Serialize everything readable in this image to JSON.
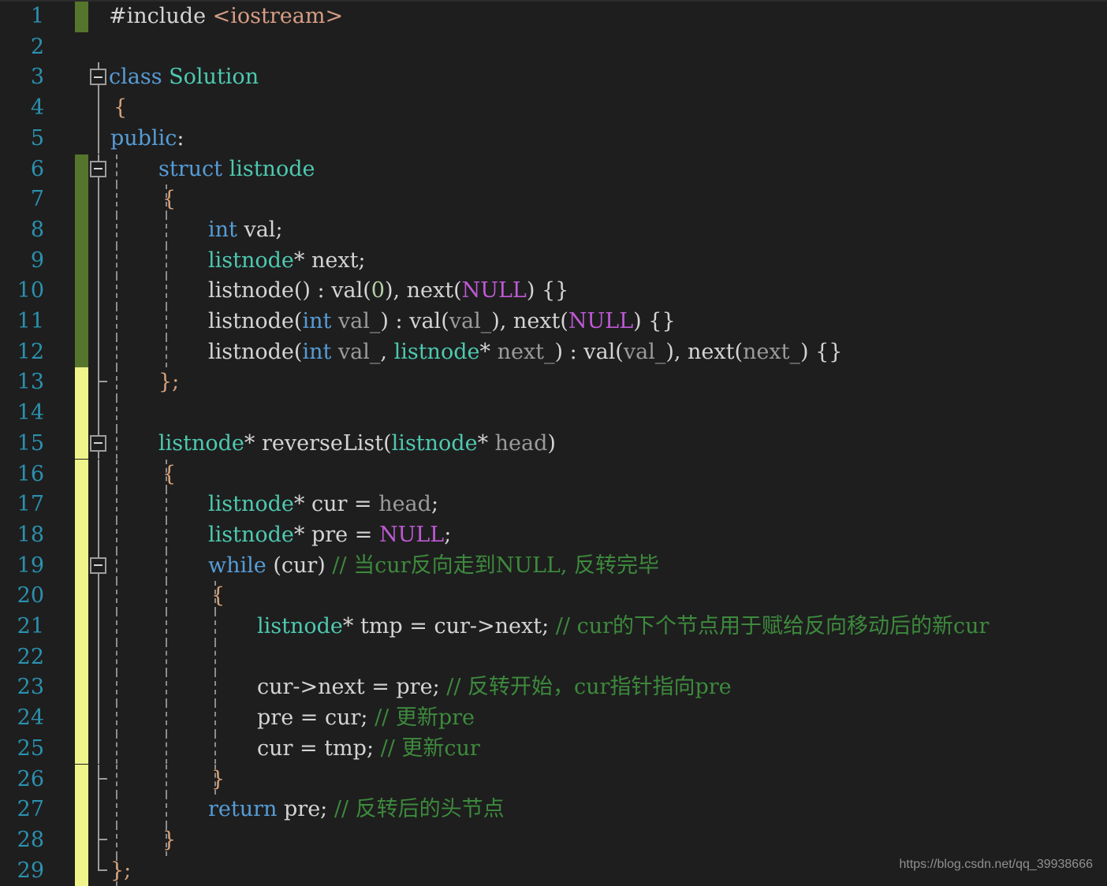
{
  "editor": {
    "background": "#1e1e1e",
    "line_number_color": "#2b91af",
    "change_marker_saved_color": "#55752c",
    "change_marker_unsaved_color": "#eef48a",
    "comment_color": "#3d8a3d",
    "keyword_color": "#569cd6",
    "type_color": "#4ec9b0",
    "string_color": "#d69d85",
    "macro_color": "#be5ad4",
    "number_color": "#b5cea8",
    "variable_color": "#9b9b9b",
    "default_text_color": "#d4d4d4",
    "language": "C++",
    "total_lines": 29
  },
  "watermark": {
    "text": "https://blog.csdn.net/qq_39938666"
  },
  "line_numbers": [
    "1",
    "2",
    "3",
    "4",
    "5",
    "6",
    "7",
    "8",
    "9",
    "10",
    "11",
    "12",
    "13",
    "14",
    "15",
    "16",
    "17",
    "18",
    "19",
    "20",
    "21",
    "22",
    "23",
    "24",
    "25",
    "26",
    "27",
    "28",
    "29"
  ],
  "change_markers": [
    "green",
    "none",
    "none",
    "none",
    "none",
    "green",
    "green",
    "green",
    "green",
    "green",
    "green",
    "green",
    "yellow",
    "yellow",
    "yellow",
    "yellow",
    "yellow",
    "yellow",
    "yellow",
    "yellow",
    "yellow",
    "yellow",
    "yellow",
    "yellow",
    "yellow",
    "yellow",
    "yellow",
    "yellow",
    "yellow"
  ],
  "code_lines": [
    {
      "n": "1",
      "text": "#include <iostream>"
    },
    {
      "n": "2",
      "text": ""
    },
    {
      "n": "3",
      "text": "class Solution"
    },
    {
      "n": "4",
      "text": "{"
    },
    {
      "n": "5",
      "text": "public:"
    },
    {
      "n": "6",
      "text": "    struct listnode"
    },
    {
      "n": "7",
      "text": "    {"
    },
    {
      "n": "8",
      "text": "        int val;"
    },
    {
      "n": "9",
      "text": "        listnode* next;"
    },
    {
      "n": "10",
      "text": "        listnode() : val(0), next(NULL) {}"
    },
    {
      "n": "11",
      "text": "        listnode(int val_) : val(val_), next(NULL) {}"
    },
    {
      "n": "12",
      "text": "        listnode(int val_, listnode* next_) : val(val_), next(next_) {}"
    },
    {
      "n": "13",
      "text": "    };"
    },
    {
      "n": "14",
      "text": ""
    },
    {
      "n": "15",
      "text": "    listnode* reverseList(listnode* head)"
    },
    {
      "n": "16",
      "text": "    {"
    },
    {
      "n": "17",
      "text": "        listnode* cur = head;"
    },
    {
      "n": "18",
      "text": "        listnode* pre = NULL;"
    },
    {
      "n": "19",
      "text": "        while (cur) // 当cur反向走到NULL, 反转完毕"
    },
    {
      "n": "20",
      "text": "        {"
    },
    {
      "n": "21",
      "text": "            listnode* tmp = cur->next; // cur的下个节点用于赋给反向移动后的新cur"
    },
    {
      "n": "22",
      "text": ""
    },
    {
      "n": "23",
      "text": "            cur->next = pre; // 反转开始，cur指针指向pre"
    },
    {
      "n": "24",
      "text": "            pre = cur; // 更新pre"
    },
    {
      "n": "25",
      "text": "            cur = tmp; // 更新cur"
    },
    {
      "n": "26",
      "text": "        }"
    },
    {
      "n": "27",
      "text": "        return pre; // 反转后的头节点"
    },
    {
      "n": "28",
      "text": "    }"
    },
    {
      "n": "29",
      "text": "};"
    }
  ],
  "comments": {
    "line19": "// 当cur反向走到NULL, 反转完毕",
    "line21": "// cur的下个节点用于赋给反向移动后的新cur",
    "line23": "// 反转开始，cur指针指向pre",
    "line24": "// 更新pre",
    "line25": "// 更新cur",
    "line27": "// 反转后的头节点"
  },
  "fold_regions": [
    {
      "start_line": "3",
      "end_line": "29",
      "label": "class-Solution-fold"
    },
    {
      "start_line": "6",
      "end_line": "13",
      "label": "struct-listnode-fold"
    },
    {
      "start_line": "15",
      "end_line": "28",
      "label": "reverseList-fold"
    },
    {
      "start_line": "19",
      "end_line": "26",
      "label": "while-loop-fold"
    }
  ],
  "tokens": {
    "l1": [
      {
        "t": "#include",
        "c": "pre"
      },
      {
        "t": " ",
        "c": "punc"
      },
      {
        "t": "<iostream>",
        "c": "str"
      }
    ],
    "l3": [
      {
        "t": "class",
        "c": "kw"
      },
      {
        "t": " ",
        "c": "punc"
      },
      {
        "t": "Solution",
        "c": "type"
      }
    ],
    "l4": [
      {
        "t": "{",
        "c": "brace"
      }
    ],
    "l5": [
      {
        "t": "public",
        "c": "kw"
      },
      {
        "t": ":",
        "c": "punc"
      }
    ],
    "l6": [
      {
        "t": "struct",
        "c": "kw"
      },
      {
        "t": " ",
        "c": "punc"
      },
      {
        "t": "listnode",
        "c": "type"
      }
    ],
    "l7": [
      {
        "t": "{",
        "c": "brace"
      }
    ],
    "l8": [
      {
        "t": "int",
        "c": "kw"
      },
      {
        "t": " val;",
        "c": "punc"
      }
    ],
    "l9": [
      {
        "t": "listnode",
        "c": "type"
      },
      {
        "t": "* next;",
        "c": "punc"
      }
    ],
    "l10": [
      {
        "t": "listnode",
        "c": "fn"
      },
      {
        "t": "() : val(",
        "c": "punc"
      },
      {
        "t": "0",
        "c": "num"
      },
      {
        "t": "), next(",
        "c": "punc"
      },
      {
        "t": "NULL",
        "c": "mac"
      },
      {
        "t": ") {}",
        "c": "punc"
      }
    ],
    "l11": [
      {
        "t": "listnode",
        "c": "fn"
      },
      {
        "t": "(",
        "c": "punc"
      },
      {
        "t": "int",
        "c": "kw"
      },
      {
        "t": " ",
        "c": "punc"
      },
      {
        "t": "val_",
        "c": "var"
      },
      {
        "t": ") : val(",
        "c": "punc"
      },
      {
        "t": "val_",
        "c": "var"
      },
      {
        "t": "), next(",
        "c": "punc"
      },
      {
        "t": "NULL",
        "c": "mac"
      },
      {
        "t": ") {}",
        "c": "punc"
      }
    ],
    "l12": [
      {
        "t": "listnode",
        "c": "fn"
      },
      {
        "t": "(",
        "c": "punc"
      },
      {
        "t": "int",
        "c": "kw"
      },
      {
        "t": " ",
        "c": "punc"
      },
      {
        "t": "val_",
        "c": "var"
      },
      {
        "t": ", ",
        "c": "punc"
      },
      {
        "t": "listnode",
        "c": "type"
      },
      {
        "t": "* ",
        "c": "punc"
      },
      {
        "t": "next_",
        "c": "var"
      },
      {
        "t": ") : val(",
        "c": "punc"
      },
      {
        "t": "val_",
        "c": "var"
      },
      {
        "t": "), next(",
        "c": "punc"
      },
      {
        "t": "next_",
        "c": "var"
      },
      {
        "t": ") {}",
        "c": "punc"
      }
    ],
    "l13": [
      {
        "t": "};",
        "c": "brace"
      }
    ],
    "l15": [
      {
        "t": "listnode",
        "c": "type"
      },
      {
        "t": "* ",
        "c": "punc"
      },
      {
        "t": "reverseList",
        "c": "fn"
      },
      {
        "t": "(",
        "c": "punc"
      },
      {
        "t": "listnode",
        "c": "type"
      },
      {
        "t": "* ",
        "c": "punc"
      },
      {
        "t": "head",
        "c": "var"
      },
      {
        "t": ")",
        "c": "punc"
      }
    ],
    "l16": [
      {
        "t": "{",
        "c": "brace"
      }
    ],
    "l17": [
      {
        "t": "listnode",
        "c": "type"
      },
      {
        "t": "* cur = ",
        "c": "punc"
      },
      {
        "t": "head",
        "c": "var"
      },
      {
        "t": ";",
        "c": "punc"
      }
    ],
    "l18": [
      {
        "t": "listnode",
        "c": "type"
      },
      {
        "t": "* pre = ",
        "c": "punc"
      },
      {
        "t": "NULL",
        "c": "mac"
      },
      {
        "t": ";",
        "c": "punc"
      }
    ],
    "l19": [
      {
        "t": "while",
        "c": "kw"
      },
      {
        "t": " (cur) ",
        "c": "punc"
      },
      {
        "t": "// 当cur反向走到NULL, 反转完毕",
        "c": "cmt"
      }
    ],
    "l20": [
      {
        "t": "{",
        "c": "brace"
      }
    ],
    "l21": [
      {
        "t": "listnode",
        "c": "type"
      },
      {
        "t": "* tmp = cur->next; ",
        "c": "punc"
      },
      {
        "t": "// cur的下个节点用于赋给反向移动后的新cur",
        "c": "cmt"
      }
    ],
    "l23": [
      {
        "t": "cur->next = pre; ",
        "c": "punc"
      },
      {
        "t": "// 反转开始，cur指针指向pre",
        "c": "cmt"
      }
    ],
    "l24": [
      {
        "t": "pre = cur; ",
        "c": "punc"
      },
      {
        "t": "// 更新pre",
        "c": "cmt"
      }
    ],
    "l25": [
      {
        "t": "cur = tmp; ",
        "c": "punc"
      },
      {
        "t": "// 更新cur",
        "c": "cmt"
      }
    ],
    "l26": [
      {
        "t": "}",
        "c": "brace"
      }
    ],
    "l27": [
      {
        "t": "return",
        "c": "kw"
      },
      {
        "t": " pre; ",
        "c": "punc"
      },
      {
        "t": "// 反转后的头节点",
        "c": "cmt"
      }
    ],
    "l28": [
      {
        "t": "}",
        "c": "brace"
      }
    ],
    "l29": [
      {
        "t": "};",
        "c": "brace"
      }
    ]
  }
}
